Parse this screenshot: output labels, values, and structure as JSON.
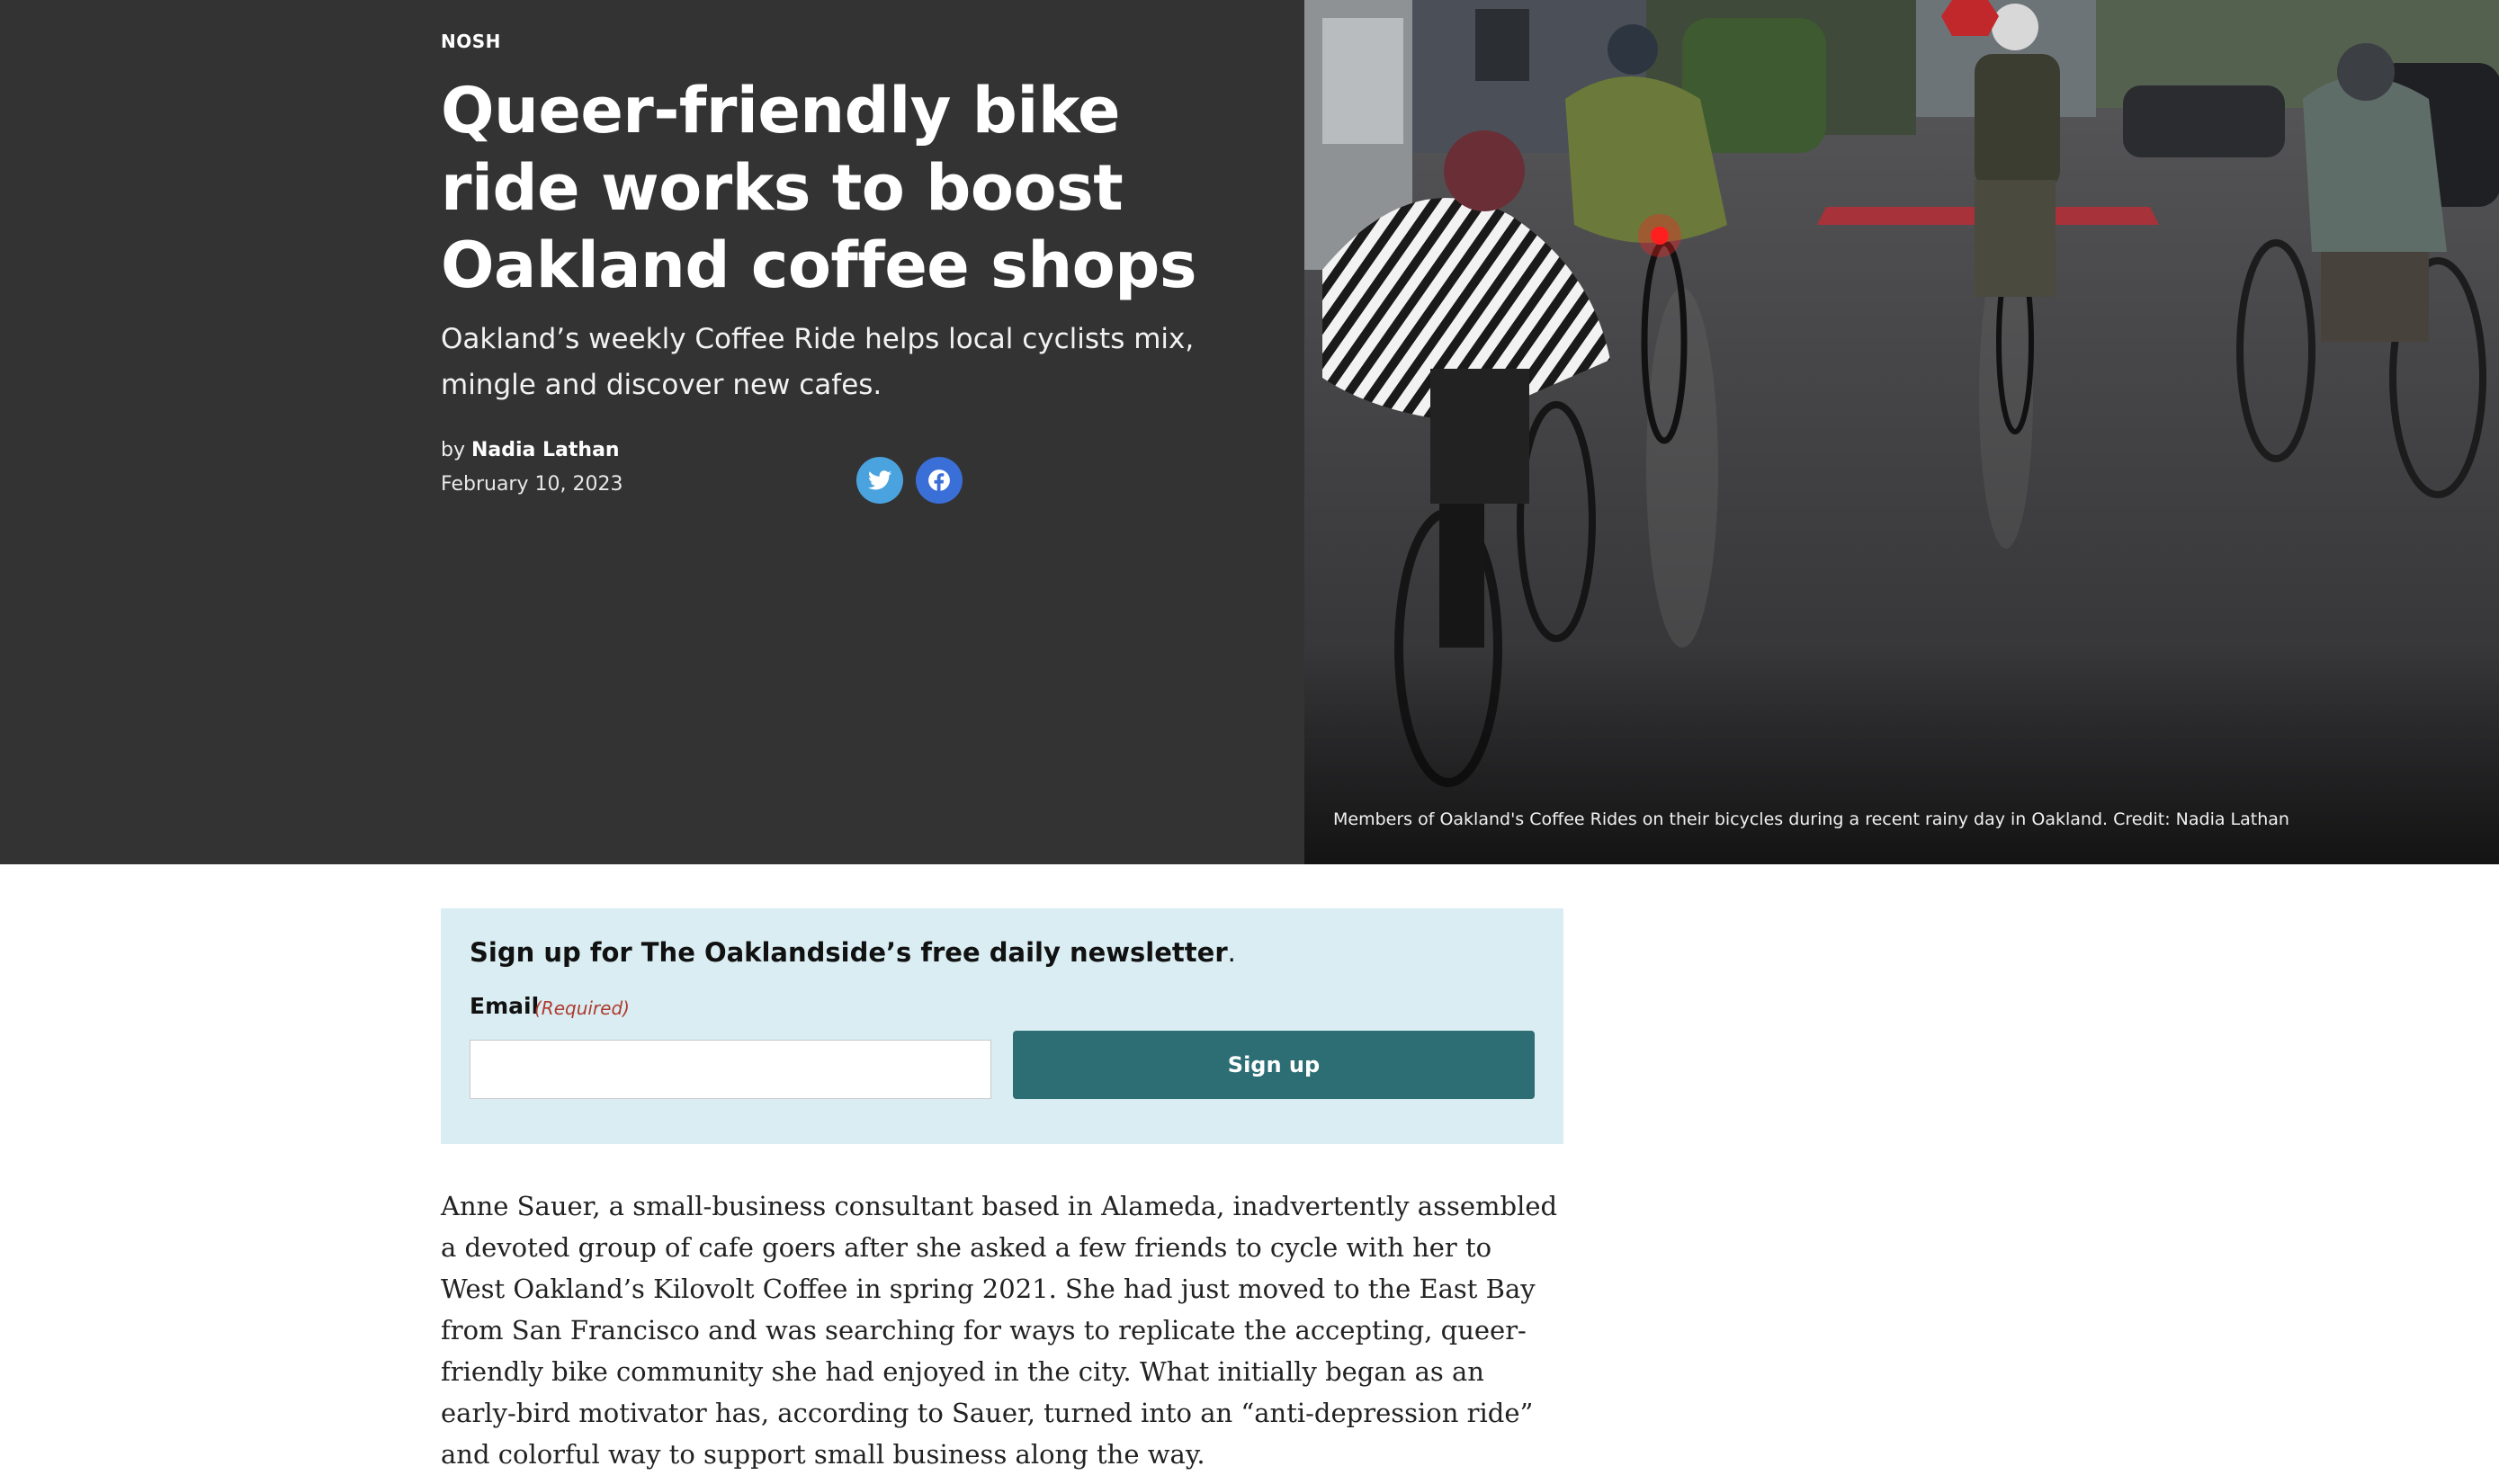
{
  "header": {
    "kicker": "NOSH",
    "headline": "Queer-friendly bike ride works to boost Oakland coffee shops",
    "dek": "Oakland’s weekly Coffee Ride helps local cyclists mix, mingle and discover new cafes.",
    "byline_prefix": "by",
    "author": "Nadia Lathan",
    "date": "February 10, 2023"
  },
  "share": {
    "twitter_icon": "twitter-icon",
    "facebook_icon": "facebook-icon"
  },
  "photo": {
    "caption": "Members of Oakland's Coffee Rides on their bicycles during a recent rainy day in Oakland. Credit: Nadia Lathan"
  },
  "newsletter": {
    "title": "Sign up for The Oaklandside’s free daily newsletter",
    "title_suffix": ".",
    "email_label": "Email",
    "required_label": "(Required)",
    "email_value": "",
    "button_label": "Sign up"
  },
  "article": {
    "paragraph_1": "Anne Sauer, a small-business consultant based in Alameda, inadvertently assembled a devoted group of cafe goers after she asked a few friends to cycle with her to West Oakland’s Kilovolt Coffee in spring 2021. She had just moved to the East Bay from San Francisco and was searching for ways to replicate the accepting, queer-friendly bike community she had enjoyed in the city. What initially began as an early-bird motivator has, according to Sauer, turned into an “anti-depression ride” and colorful way to support small business along the way."
  },
  "colors": {
    "hero_bg": "#333333",
    "newsletter_bg": "#d9edf2",
    "button_bg": "#2d6e74",
    "required_red": "#b03a2e"
  }
}
